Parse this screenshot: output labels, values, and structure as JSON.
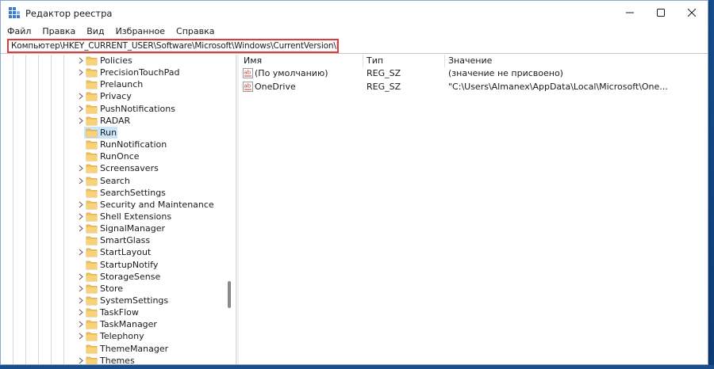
{
  "window": {
    "title": "Редактор реестра",
    "controls": {
      "minimize": "minimize-icon",
      "maximize": "maximize-icon",
      "close": "close-icon"
    }
  },
  "menu": [
    "Файл",
    "Правка",
    "Вид",
    "Избранное",
    "Справка"
  ],
  "address": {
    "value": "Компьютер\\HKEY_CURRENT_USER\\Software\\Microsoft\\Windows\\CurrentVersion\\Run"
  },
  "tree": {
    "items": [
      {
        "label": "Policies",
        "expandable": true
      },
      {
        "label": "PrecisionTouchPad",
        "expandable": true
      },
      {
        "label": "Prelaunch",
        "expandable": false
      },
      {
        "label": "Privacy",
        "expandable": true
      },
      {
        "label": "PushNotifications",
        "expandable": true
      },
      {
        "label": "RADAR",
        "expandable": true
      },
      {
        "label": "Run",
        "expandable": false,
        "selected": true
      },
      {
        "label": "RunNotification",
        "expandable": false
      },
      {
        "label": "RunOnce",
        "expandable": false
      },
      {
        "label": "Screensavers",
        "expandable": true
      },
      {
        "label": "Search",
        "expandable": true
      },
      {
        "label": "SearchSettings",
        "expandable": false
      },
      {
        "label": "Security and Maintenance",
        "expandable": true
      },
      {
        "label": "Shell Extensions",
        "expandable": true
      },
      {
        "label": "SignalManager",
        "expandable": true
      },
      {
        "label": "SmartGlass",
        "expandable": false
      },
      {
        "label": "StartLayout",
        "expandable": true
      },
      {
        "label": "StartupNotify",
        "expandable": false
      },
      {
        "label": "StorageSense",
        "expandable": true
      },
      {
        "label": "Store",
        "expandable": true
      },
      {
        "label": "SystemSettings",
        "expandable": true
      },
      {
        "label": "TaskFlow",
        "expandable": true
      },
      {
        "label": "TaskManager",
        "expandable": true
      },
      {
        "label": "Telephony",
        "expandable": true
      },
      {
        "label": "ThemeManager",
        "expandable": false
      },
      {
        "label": "Themes",
        "expandable": true
      }
    ]
  },
  "list": {
    "columns": [
      "Имя",
      "Тип",
      "Значение"
    ],
    "rows": [
      {
        "name": "(По умолчанию)",
        "type": "REG_SZ",
        "value": "(значение не присвоено)",
        "icon": "string-value-icon"
      },
      {
        "name": "OneDrive",
        "type": "REG_SZ",
        "value": "\"C:\\Users\\Almanex\\AppData\\Local\\Microsoft\\One...",
        "icon": "string-value-icon"
      }
    ]
  },
  "colors": {
    "address_highlight": "#e03a3a",
    "selection": "#cce4f7",
    "folder": "#f2c35a"
  }
}
